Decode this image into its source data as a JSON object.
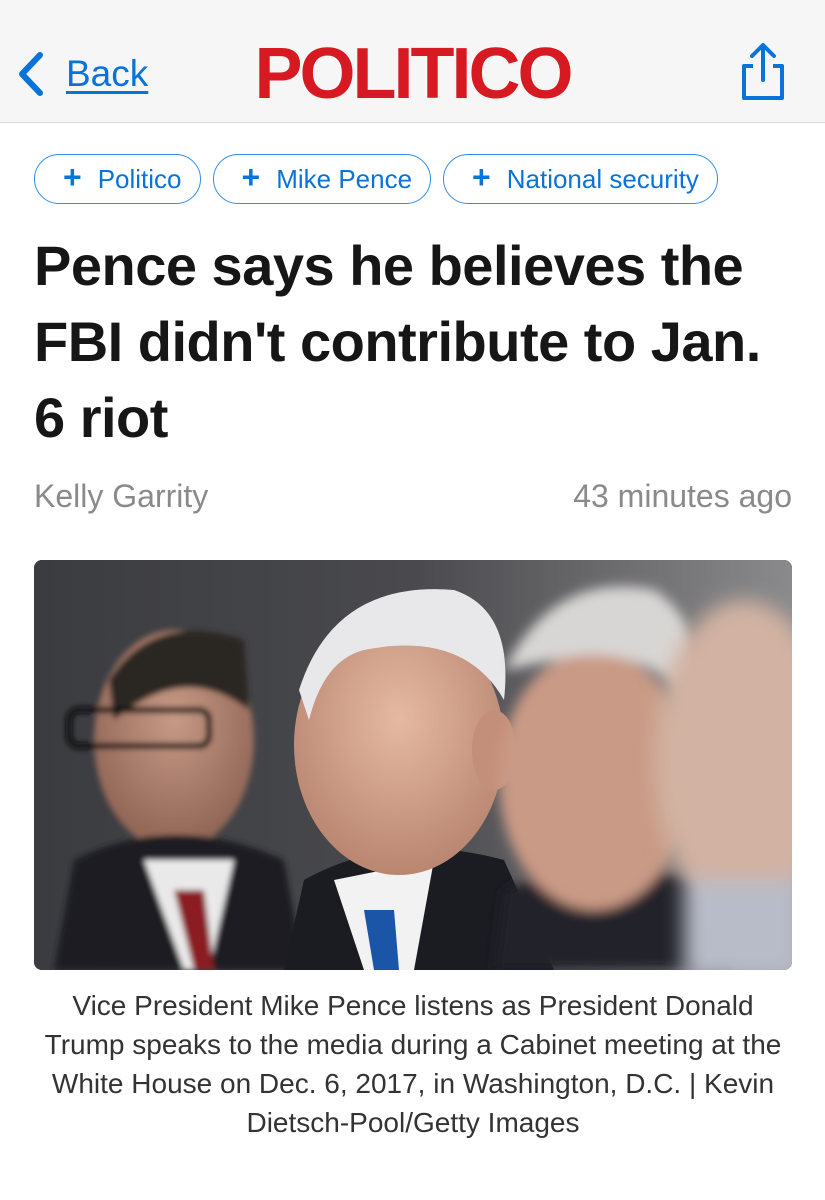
{
  "nav": {
    "back_label": "Back",
    "brand": "POLITICO",
    "accent_color": "#0a73d9",
    "brand_color": "#d71a21",
    "icons": [
      "chevron-left-icon",
      "share-icon"
    ]
  },
  "tags": [
    {
      "label": "Politico"
    },
    {
      "label": "Mike Pence"
    },
    {
      "label": "National security"
    }
  ],
  "article": {
    "headline": "Pence says he believes the FBI didn't contribute to Jan. 6 riot",
    "author": "Kelly Garrity",
    "timestamp": "43 minutes ago",
    "caption": "Vice President Mike Pence listens as President Donald Trump speaks to the media during a Cabinet meeting at the White House on Dec. 6, 2017, in Washington, D.C. | Kevin Dietsch-Pool/Getty Images"
  }
}
